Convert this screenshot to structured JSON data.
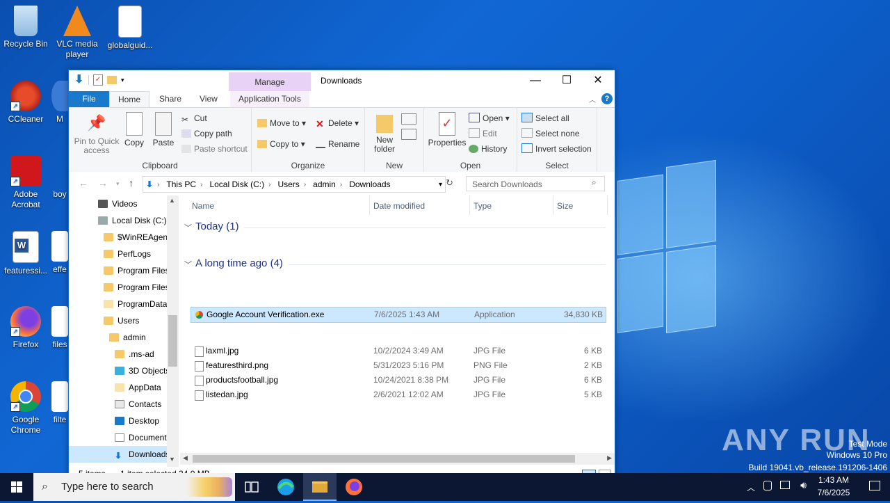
{
  "desktop": {
    "icons": [
      {
        "label": "Recycle Bin",
        "icon": "recycle-bin-icon"
      },
      {
        "label": "VLC media player",
        "icon": "vlc-icon"
      },
      {
        "label": "globalguid...",
        "icon": "image-file-icon"
      },
      {
        "label": "CCleaner",
        "icon": "ccleaner-icon"
      },
      {
        "label": "M",
        "icon": "app-icon"
      },
      {
        "label": "Adobe Acrobat",
        "icon": "acrobat-icon"
      },
      {
        "label": "boy",
        "icon": "app-icon"
      },
      {
        "label": "featuressi...",
        "icon": "word-icon"
      },
      {
        "label": "effe",
        "icon": "word-icon"
      },
      {
        "label": "Firefox",
        "icon": "firefox-icon"
      },
      {
        "label": "files",
        "icon": "file-icon"
      },
      {
        "label": "Google Chrome",
        "icon": "chrome-icon"
      },
      {
        "label": "filte",
        "icon": "file-icon"
      }
    ],
    "watermark": "ANY RUN",
    "test_mode": [
      "Test Mode",
      "Windows 10 Pro",
      "Build 19041.vb_release.191206-1406"
    ]
  },
  "explorer": {
    "title": "Downloads",
    "manage_tab": "Manage",
    "tabs": {
      "file": "File",
      "home": "Home",
      "share": "Share",
      "view": "View",
      "app_tools": "Application Tools"
    },
    "ribbon": {
      "clipboard": {
        "label": "Clipboard",
        "pin": "Pin to Quick access",
        "copy": "Copy",
        "paste": "Paste",
        "cut": "Cut",
        "copy_path": "Copy path",
        "paste_shortcut": "Paste shortcut"
      },
      "organize": {
        "label": "Organize",
        "move_to": "Move to",
        "copy_to": "Copy to",
        "delete": "Delete",
        "rename": "Rename"
      },
      "new": {
        "label": "New",
        "new_folder": "New folder"
      },
      "open": {
        "label": "Open",
        "properties": "Properties",
        "open": "Open",
        "edit": "Edit",
        "history": "History"
      },
      "select": {
        "label": "Select",
        "select_all": "Select all",
        "select_none": "Select none",
        "invert": "Invert selection"
      }
    },
    "address": [
      "This PC",
      "Local Disk (C:)",
      "Users",
      "admin",
      "Downloads"
    ],
    "search_placeholder": "Search Downloads",
    "nav": [
      "Videos",
      "Local Disk (C:)",
      "$WinREAgent",
      "PerfLogs",
      "Program Files",
      "Program Files",
      "ProgramData",
      "Users",
      "admin",
      ".ms-ad",
      "3D Objects",
      "AppData",
      "Contacts",
      "Desktop",
      "Documents",
      "Downloads"
    ],
    "columns": {
      "name": "Name",
      "date": "Date modified",
      "type": "Type",
      "size": "Size"
    },
    "groups": [
      {
        "title": "Today (1)",
        "files": [
          {
            "name": "Google Account Verification.exe",
            "date": "7/6/2025 1:43 AM",
            "type": "Application",
            "size": "34,830 KB"
          }
        ]
      },
      {
        "title": "A long time ago (4)",
        "files": [
          {
            "name": "laxml.jpg",
            "date": "10/2/2024 3:49 AM",
            "type": "JPG File",
            "size": "6 KB"
          },
          {
            "name": "featuresthird.png",
            "date": "5/31/2023 5:16 PM",
            "type": "PNG File",
            "size": "2 KB"
          },
          {
            "name": "productsfootball.jpg",
            "date": "10/24/2021 8:38 PM",
            "type": "JPG File",
            "size": "6 KB"
          },
          {
            "name": "listedan.jpg",
            "date": "2/6/2021 12:02 AM",
            "type": "JPG File",
            "size": "5 KB"
          }
        ]
      }
    ],
    "status": {
      "items": "5 items",
      "selected": "1 item selected  34.0 MB"
    }
  },
  "taskbar": {
    "search_placeholder": "Type here to search",
    "time": "1:43 AM",
    "date": "7/6/2025"
  }
}
